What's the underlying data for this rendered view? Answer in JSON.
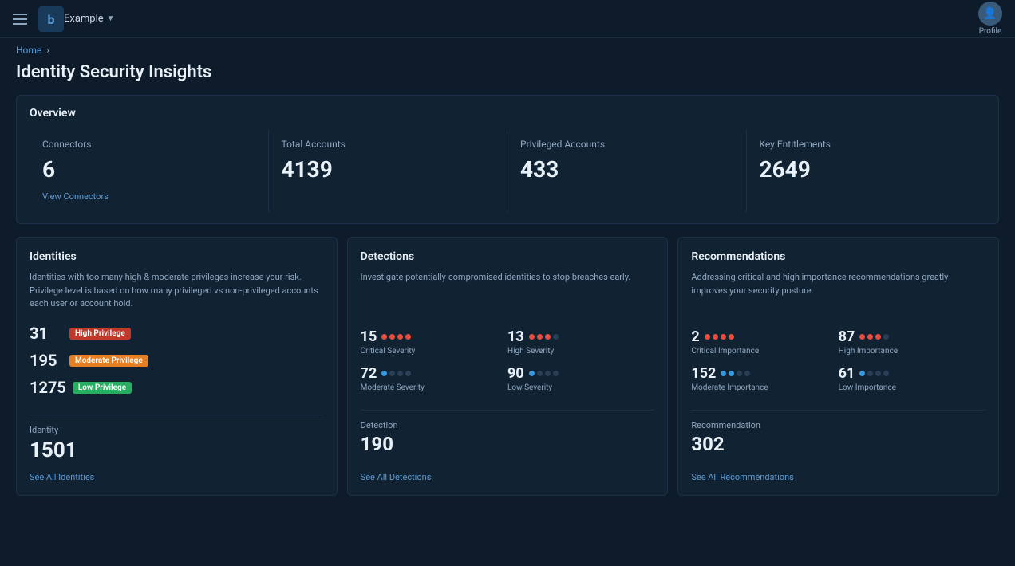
{
  "app": {
    "menu_label": "Menu",
    "example_label": "Example",
    "profile_label": "Profile"
  },
  "breadcrumb": {
    "home": "Home",
    "separator": "›"
  },
  "page": {
    "title": "Identity Security Insights"
  },
  "overview": {
    "title": "Overview",
    "stats": [
      {
        "label": "Connectors",
        "value": "6",
        "link": "View Connectors",
        "link_key": "view_connectors"
      },
      {
        "label": "Total Accounts",
        "value": "4139",
        "link": "",
        "link_key": ""
      },
      {
        "label": "Privileged Accounts",
        "value": "433",
        "link": "",
        "link_key": ""
      },
      {
        "label": "Key Entitlements",
        "value": "2649",
        "link": "",
        "link_key": ""
      }
    ]
  },
  "panels": {
    "identities": {
      "title": "Identities",
      "desc": "Identities with too many high & moderate privileges increase your risk. Privilege level is based on how many privileged vs non-privileged accounts each user or account hold.",
      "rows": [
        {
          "count": "31",
          "badge": "High Privilege",
          "badge_type": "high"
        },
        {
          "count": "195",
          "badge": "Moderate Privilege",
          "badge_type": "moderate"
        },
        {
          "count": "1275",
          "badge": "Low Privilege",
          "badge_type": "low"
        }
      ],
      "total_label": "Identity",
      "total_value": "1501",
      "see_all": "See All Identities"
    },
    "detections": {
      "title": "Detections",
      "desc": "Investigate potentially-compromised identities to stop breaches early.",
      "items": [
        {
          "num": "15",
          "dots": [
            "filled",
            "filled",
            "filled",
            "filled"
          ],
          "dot_type": "critical",
          "label": "Critical Severity"
        },
        {
          "num": "13",
          "dots": [
            "filled",
            "filled",
            "filled",
            "empty"
          ],
          "dot_type": "high",
          "label": "High Severity"
        },
        {
          "num": "72",
          "dots": [
            "filled",
            "empty",
            "empty",
            "empty"
          ],
          "dot_type": "moderate",
          "label": "Moderate Severity"
        },
        {
          "num": "90",
          "dots": [
            "filled",
            "empty",
            "empty",
            "empty"
          ],
          "dot_type": "moderate",
          "label": "Low Severity"
        }
      ],
      "total_label": "Detection",
      "total_value": "190",
      "see_all": "See All Detections"
    },
    "recommendations": {
      "title": "Recommendations",
      "desc": "Addressing critical and high importance recommendations greatly improves your security posture.",
      "items": [
        {
          "num": "2",
          "dots": [
            "filled",
            "filled",
            "filled",
            "filled"
          ],
          "dot_type": "critical",
          "label": "Critical Importance"
        },
        {
          "num": "87",
          "dots": [
            "filled",
            "filled",
            "filled",
            "empty"
          ],
          "dot_type": "high",
          "label": "High Importance"
        },
        {
          "num": "152",
          "dots": [
            "filled",
            "filled",
            "empty",
            "empty"
          ],
          "dot_type": "moderate",
          "label": "Moderate Importance"
        },
        {
          "num": "61",
          "dots": [
            "filled",
            "empty",
            "empty",
            "empty"
          ],
          "dot_type": "moderate",
          "label": "Low Importance"
        }
      ],
      "total_label": "Recommendation",
      "total_value": "302",
      "see_all": "See All Recommendations"
    }
  }
}
